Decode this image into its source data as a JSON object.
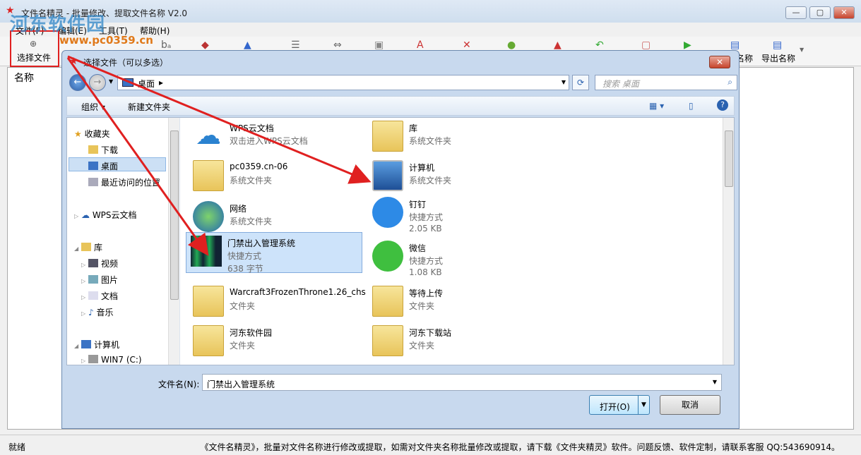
{
  "app": {
    "title": "文件名精灵 - 批量修改、提取文件名称  V2.0",
    "watermark": "河东软件园",
    "watermark_url": "www.pc0359.cn"
  },
  "menu": [
    "文件(F)",
    "编辑(E)",
    "工具(T)",
    "帮助(H)"
  ],
  "toolbar": {
    "select_file": "选择文件",
    "name_btn": "名称",
    "export_names": "导出名称"
  },
  "main": {
    "column_name": "名称"
  },
  "status": {
    "left": "就绪",
    "right": "《文件名精灵》，批量对文件名称进行修改或提取，如需对文件夹名称批量修改或提取，请下载《文件夹精灵》软件。问题反馈、软件定制，请联系客服 QQ:543690914。"
  },
  "dialog": {
    "title": "选择文件（可以多选）",
    "address": "桌面",
    "search_placeholder": "搜索 桌面",
    "organize": "组织",
    "new_folder": "新建文件夹",
    "nav": {
      "favorites": "收藏夹",
      "downloads": "下载",
      "desktop": "桌面",
      "recent": "最近访问的位置",
      "wps": "WPS云文档",
      "libraries": "库",
      "videos": "视频",
      "pictures": "图片",
      "documents": "文档",
      "music": "音乐",
      "computer": "计算机",
      "drive_c": "WIN7 (C:)"
    },
    "files": [
      {
        "name": "WPS云文档",
        "sub": "双击进入WPS云文档",
        "sub2": ""
      },
      {
        "name": "库",
        "sub": "系统文件夹",
        "sub2": ""
      },
      {
        "name": "pc0359.cn-06",
        "sub": "系统文件夹",
        "sub2": ""
      },
      {
        "name": "计算机",
        "sub": "系统文件夹",
        "sub2": ""
      },
      {
        "name": "网络",
        "sub": "系统文件夹",
        "sub2": ""
      },
      {
        "name": "钉钉",
        "sub": "快捷方式",
        "sub2": "2.05 KB"
      },
      {
        "name": "门禁出入管理系统",
        "sub": "快捷方式",
        "sub2": "638 字节"
      },
      {
        "name": "微信",
        "sub": "快捷方式",
        "sub2": "1.08 KB"
      },
      {
        "name": "Warcraft3FrozenThrone1.26_chs",
        "sub": "文件夹",
        "sub2": ""
      },
      {
        "name": "等待上传",
        "sub": "文件夹",
        "sub2": ""
      },
      {
        "name": "河东软件园",
        "sub": "文件夹",
        "sub2": ""
      },
      {
        "name": "河东下载站",
        "sub": "文件夹",
        "sub2": ""
      }
    ],
    "filename_label": "文件名(N):",
    "filename_value": "门禁出入管理系统",
    "open": "打开(O)",
    "cancel": "取消"
  }
}
